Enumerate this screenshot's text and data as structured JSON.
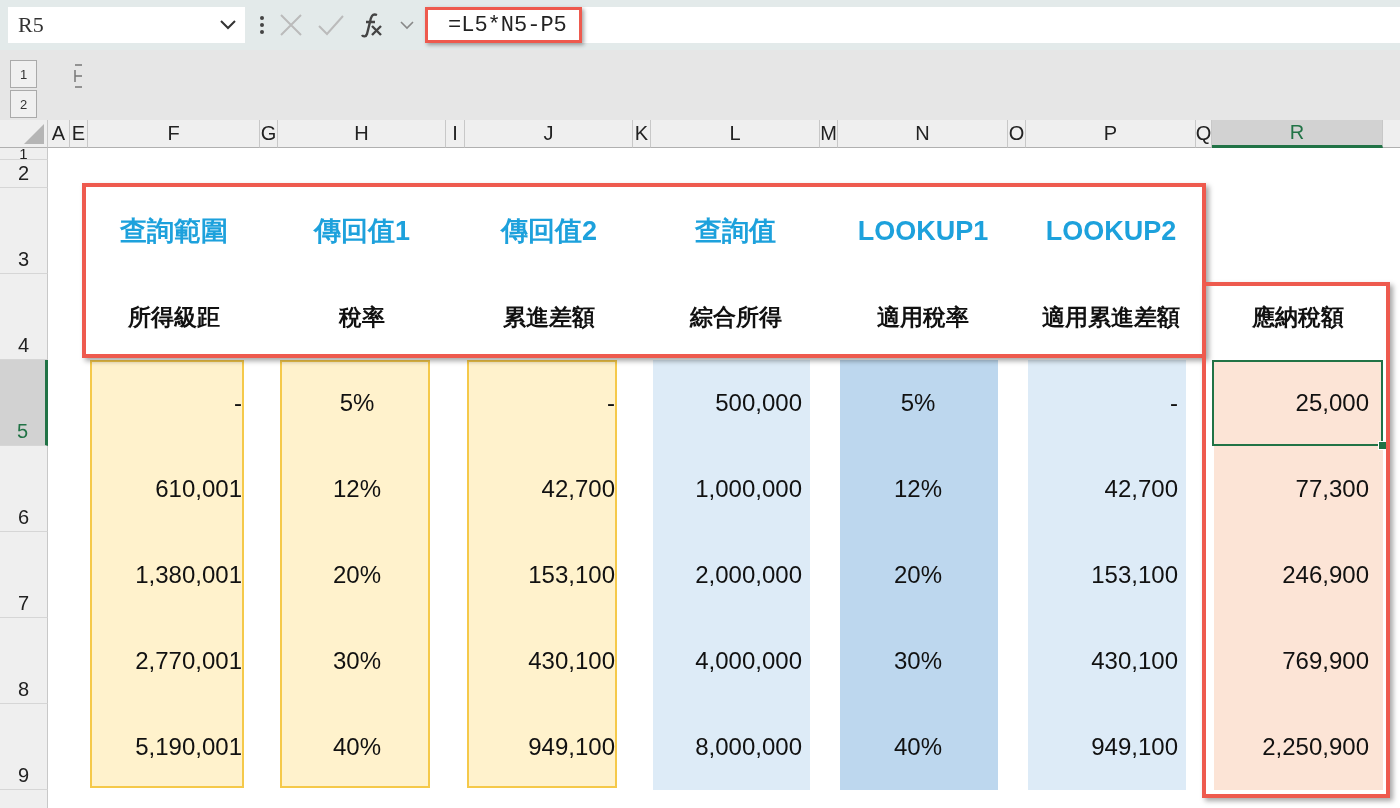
{
  "formula_bar": {
    "name_box": "R5",
    "formula": "=L5*N5-P5"
  },
  "outline_buttons": [
    "1",
    "2"
  ],
  "column_headers": [
    {
      "label": "A",
      "selected": false
    },
    {
      "label": "E",
      "selected": false
    },
    {
      "label": "F",
      "selected": false
    },
    {
      "label": "G",
      "selected": false
    },
    {
      "label": "H",
      "selected": false
    },
    {
      "label": "I",
      "selected": false
    },
    {
      "label": "J",
      "selected": false
    },
    {
      "label": "K",
      "selected": false
    },
    {
      "label": "L",
      "selected": false
    },
    {
      "label": "M",
      "selected": false
    },
    {
      "label": "N",
      "selected": false
    },
    {
      "label": "O",
      "selected": false
    },
    {
      "label": "P",
      "selected": false
    },
    {
      "label": "Q",
      "selected": false
    },
    {
      "label": "R",
      "selected": true
    }
  ],
  "row_headers": [
    {
      "label": "1",
      "selected": false
    },
    {
      "label": "2",
      "selected": false
    },
    {
      "label": "3",
      "selected": false
    },
    {
      "label": "4",
      "selected": false
    },
    {
      "label": "5",
      "selected": true
    },
    {
      "label": "6",
      "selected": false
    },
    {
      "label": "7",
      "selected": false
    },
    {
      "label": "8",
      "selected": false
    },
    {
      "label": "9",
      "selected": false
    }
  ],
  "table": {
    "columns": [
      {
        "lookup_label": "查詢範圍",
        "header": "所得級距",
        "kind": "amount",
        "outlined": true,
        "color": "#fff2cc",
        "values": [
          "-",
          "610,001",
          "1,380,001",
          "2,770,001",
          "5,190,001"
        ]
      },
      {
        "lookup_label": "傳回值1",
        "header": "稅率",
        "kind": "rate",
        "outlined": true,
        "color": "#fff2cc",
        "values": [
          "5%",
          "12%",
          "20%",
          "30%",
          "40%"
        ]
      },
      {
        "lookup_label": "傳回值2",
        "header": "累進差額",
        "kind": "amount",
        "outlined": true,
        "color": "#fff2cc",
        "values": [
          "-",
          "42,700",
          "153,100",
          "430,100",
          "949,100"
        ]
      },
      {
        "lookup_label": "查詢值",
        "header": "綜合所得",
        "kind": "amount",
        "outlined": false,
        "color": "#ddebf7",
        "values": [
          "500,000",
          "1,000,000",
          "2,000,000",
          "4,000,000",
          "8,000,000"
        ]
      },
      {
        "lookup_label": "LOOKUP1",
        "header": "適用稅率",
        "kind": "rate",
        "outlined": false,
        "color": "#bdd7ee",
        "values": [
          "5%",
          "12%",
          "20%",
          "30%",
          "40%"
        ]
      },
      {
        "lookup_label": "LOOKUP2",
        "header": "適用累進差額",
        "kind": "amount",
        "outlined": false,
        "color": "#ddebf7",
        "values": [
          "-",
          "42,700",
          "153,100",
          "430,100",
          "949,100"
        ]
      }
    ],
    "result_column": {
      "header": "應納稅額",
      "color": "#fce4d6",
      "values": [
        {
          "text": "25,000",
          "selected": true
        },
        {
          "text": "77,300",
          "selected": false
        },
        {
          "text": "246,900",
          "selected": false
        },
        {
          "text": "769,900",
          "selected": false
        },
        {
          "text": "2,250,900",
          "selected": false
        }
      ]
    }
  }
}
